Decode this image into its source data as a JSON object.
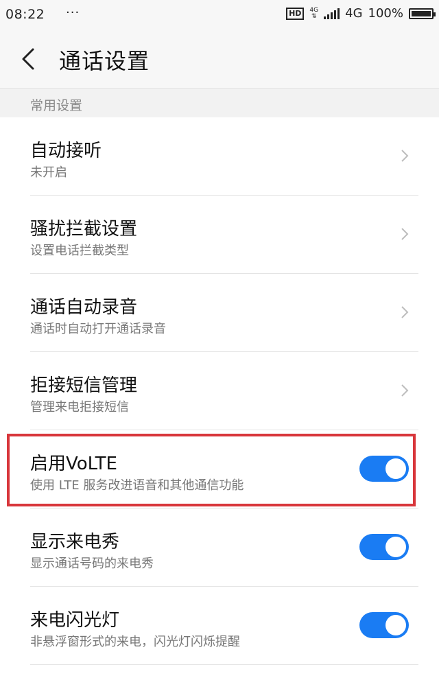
{
  "status_bar": {
    "time": "08:22",
    "dots": "···",
    "hd": "HD",
    "network_small": "4G",
    "network": "4G",
    "battery_pct": "100%"
  },
  "header": {
    "title": "通话设置"
  },
  "section": {
    "label": "常用设置"
  },
  "rows": [
    {
      "title": "自动接听",
      "subtitle": "未开启",
      "control": "chevron"
    },
    {
      "title": "骚扰拦截设置",
      "subtitle": "设置电话拦截类型",
      "control": "chevron"
    },
    {
      "title": "通话自动录音",
      "subtitle": "通话时自动打开通话录音",
      "control": "chevron"
    },
    {
      "title": "拒接短信管理",
      "subtitle": "管理来电拒接短信",
      "control": "chevron"
    },
    {
      "title": "启用VoLTE",
      "subtitle": "使用 LTE 服务改进语音和其他通信功能",
      "control": "toggle",
      "on": true
    },
    {
      "title": "显示来电秀",
      "subtitle": "显示通话号码的来电秀",
      "control": "toggle",
      "on": true
    },
    {
      "title": "来电闪光灯",
      "subtitle": "非悬浮窗形式的来电，闪光灯闪烁提醒",
      "control": "toggle",
      "on": true
    }
  ],
  "colors": {
    "toggle_on": "#1a7cf3",
    "highlight": "#d8363b"
  }
}
